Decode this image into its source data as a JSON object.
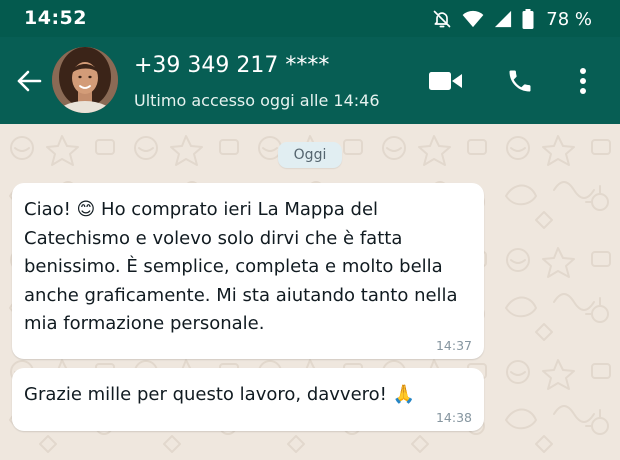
{
  "status_bar": {
    "time": "14:52",
    "battery_percent": "78 %",
    "icons": [
      "do-not-disturb-icon",
      "wifi-icon",
      "signal-icon",
      "battery-icon"
    ]
  },
  "header": {
    "contact_name": "+39 349 217 ****",
    "last_seen": "Ultimo accesso oggi alle 14:46",
    "icons": [
      "back-arrow-icon",
      "video-call-icon",
      "phone-call-icon",
      "more-options-icon"
    ],
    "colors": {
      "app_bar": "#075e54",
      "status_bar": "#045a4e"
    }
  },
  "chat": {
    "date_label": "Oggi",
    "messages": [
      {
        "text": "Ciao! 😊  Ho comprato ieri La Mappa del Catechismo e volevo solo dirvi che è fatta benissimo. È semplice, completa e molto bella anche graficamente. Mi sta aiutando tanto nella mia formazione personale.",
        "time": "14:37"
      },
      {
        "text": "Grazie mille per questo lavoro, davvero! 🙏",
        "time": "14:38"
      }
    ],
    "colors": {
      "wallpaper": "#efe7de",
      "bubble": "#ffffff",
      "date_chip": "#e1eef2"
    }
  }
}
